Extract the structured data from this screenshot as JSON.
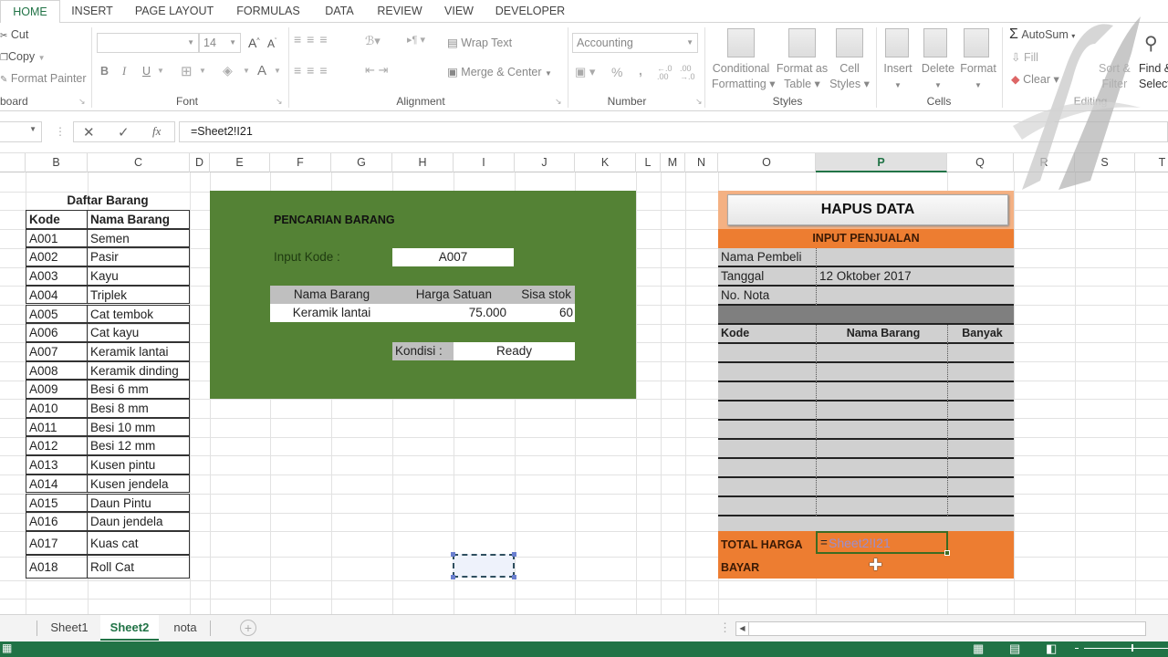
{
  "ribbon_tabs": [
    "HOME",
    "INSERT",
    "PAGE LAYOUT",
    "FORMULAS",
    "DATA",
    "REVIEW",
    "VIEW",
    "DEVELOPER"
  ],
  "active_ribbon_tab": "HOME",
  "clipboard": {
    "cut": "Cut",
    "copy": "Copy",
    "format_painter": "Format Painter",
    "label": "board"
  },
  "font": {
    "name": "",
    "size": "14",
    "label": "Font",
    "bold": "B",
    "italic": "I",
    "underline": "U"
  },
  "alignment": {
    "wrap_text": "Wrap Text",
    "merge_center": "Merge & Center",
    "label": "Alignment"
  },
  "number": {
    "format": "Accounting",
    "percent": "%",
    "comma": ",",
    "label": "Number"
  },
  "styles": {
    "conditional": "Conditional",
    "conditional2": "Formatting",
    "format_as": "Format as",
    "format_as2": "Table",
    "cell": "Cell",
    "cell2": "Styles",
    "label": "Styles"
  },
  "cells": {
    "insert": "Insert",
    "delete": "Delete",
    "format": "Format",
    "label": "Cells"
  },
  "editing": {
    "autosum": "AutoSum",
    "fill": "Fill",
    "clear": "Clear",
    "sort": "Sort &",
    "sort2": "Filter",
    "find": "Find &",
    "find2": "Select",
    "label": "Editing"
  },
  "formula_bar": {
    "name_box": "",
    "formula": "=Sheet2!I21"
  },
  "columns": [
    "B",
    "C",
    "D",
    "E",
    "F",
    "G",
    "H",
    "I",
    "J",
    "K",
    "L",
    "M",
    "N",
    "O",
    "P",
    "Q",
    "R",
    "S",
    "T"
  ],
  "selected_column": "P",
  "daftar_barang": {
    "title": "Daftar Barang",
    "headers": [
      "Kode",
      "Nama Barang"
    ],
    "rows": [
      [
        "A001",
        "Semen"
      ],
      [
        "A002",
        "Pasir"
      ],
      [
        "A003",
        "Kayu"
      ],
      [
        "A004",
        "Triplek"
      ],
      [
        "A005",
        "Cat tembok"
      ],
      [
        "A006",
        "Cat kayu"
      ],
      [
        "A007",
        "Keramik lantai"
      ],
      [
        "A008",
        "Keramik dinding"
      ],
      [
        "A009",
        "Besi 6 mm"
      ],
      [
        "A010",
        "Besi 8 mm"
      ],
      [
        "A011",
        "Besi 10 mm"
      ],
      [
        "A012",
        "Besi 12 mm"
      ],
      [
        "A013",
        "Kusen pintu"
      ],
      [
        "A014",
        "Kusen jendela"
      ],
      [
        "A015",
        "Daun Pintu"
      ],
      [
        "A016",
        "Daun jendela"
      ],
      [
        "A017",
        "Kuas cat"
      ],
      [
        "A018",
        "Roll Cat"
      ]
    ]
  },
  "pencarian": {
    "title": "PENCARIAN BARANG",
    "input_label": "Input Kode :",
    "input_value": "A007",
    "headers": [
      "Nama Barang",
      "Harga Satuan",
      "Sisa stok"
    ],
    "result": [
      "Keramik lantai",
      "75.000",
      "60"
    ],
    "kondisi_label": "Kondisi :",
    "kondisi_value": "Ready"
  },
  "penjualan": {
    "hapus_button": "HAPUS DATA",
    "title": "INPUT PENJUALAN",
    "fields": [
      {
        "label": "Nama Pembeli",
        "value": ""
      },
      {
        "label": "Tanggal",
        "value": "12 Oktober 2017"
      },
      {
        "label": "No. Nota",
        "value": ""
      }
    ],
    "headers": [
      "Kode",
      "Nama Barang",
      "Banyak"
    ],
    "total_label": "TOTAL HARGA",
    "total_formula_eq": "=",
    "total_formula_ref": "Sheet2!I21",
    "bayar_label": "BAYAR"
  },
  "sheet_tabs": [
    "Sheet1",
    "Sheet2",
    "nota"
  ],
  "active_sheet": "Sheet2",
  "colors": {
    "excel_green": "#217346",
    "panel_green": "#548235",
    "orange": "#ed7d31",
    "light_gray": "#d0d0d0"
  }
}
